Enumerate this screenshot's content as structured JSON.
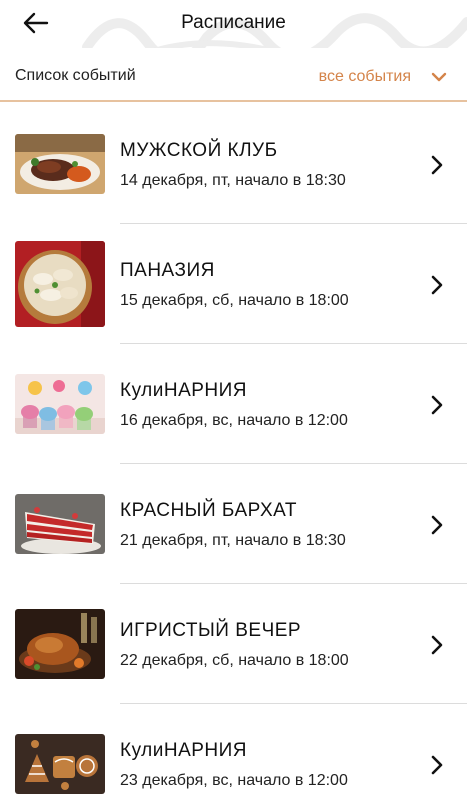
{
  "header": {
    "title": "Расписание",
    "back_icon": "arrow-left-icon"
  },
  "filter": {
    "label": "Список событий",
    "selected": "все события",
    "dropdown_icon": "chevron-down-icon",
    "accent_color": "#d4844a"
  },
  "events": [
    {
      "title": "МУЖСКОЙ КЛУБ",
      "date": "14 декабря, пт, начало в 18:30",
      "image": "steak-dish-photo"
    },
    {
      "title": "ПАНАЗИЯ",
      "date": "15 декабря, сб, начало в 18:00",
      "image": "dumplings-bowl-photo"
    },
    {
      "title": "КулиНАРНИЯ",
      "date": "16 декабря, вс, начало в 12:00",
      "image": "cupcakes-photo"
    },
    {
      "title": "КРАСНЫЙ БАРХАТ",
      "date": "21 декабря, пт, начало в 18:30",
      "image": "red-velvet-cake-photo"
    },
    {
      "title": "ИГРИСТЫЙ ВЕЧЕР",
      "date": "22 декабря, сб, начало в 18:00",
      "image": "roast-chicken-photo"
    },
    {
      "title": "КулиНАРНИЯ",
      "date": "23 декабря, вс, начало в 12:00",
      "image": "gingerbread-cookies-photo"
    }
  ]
}
